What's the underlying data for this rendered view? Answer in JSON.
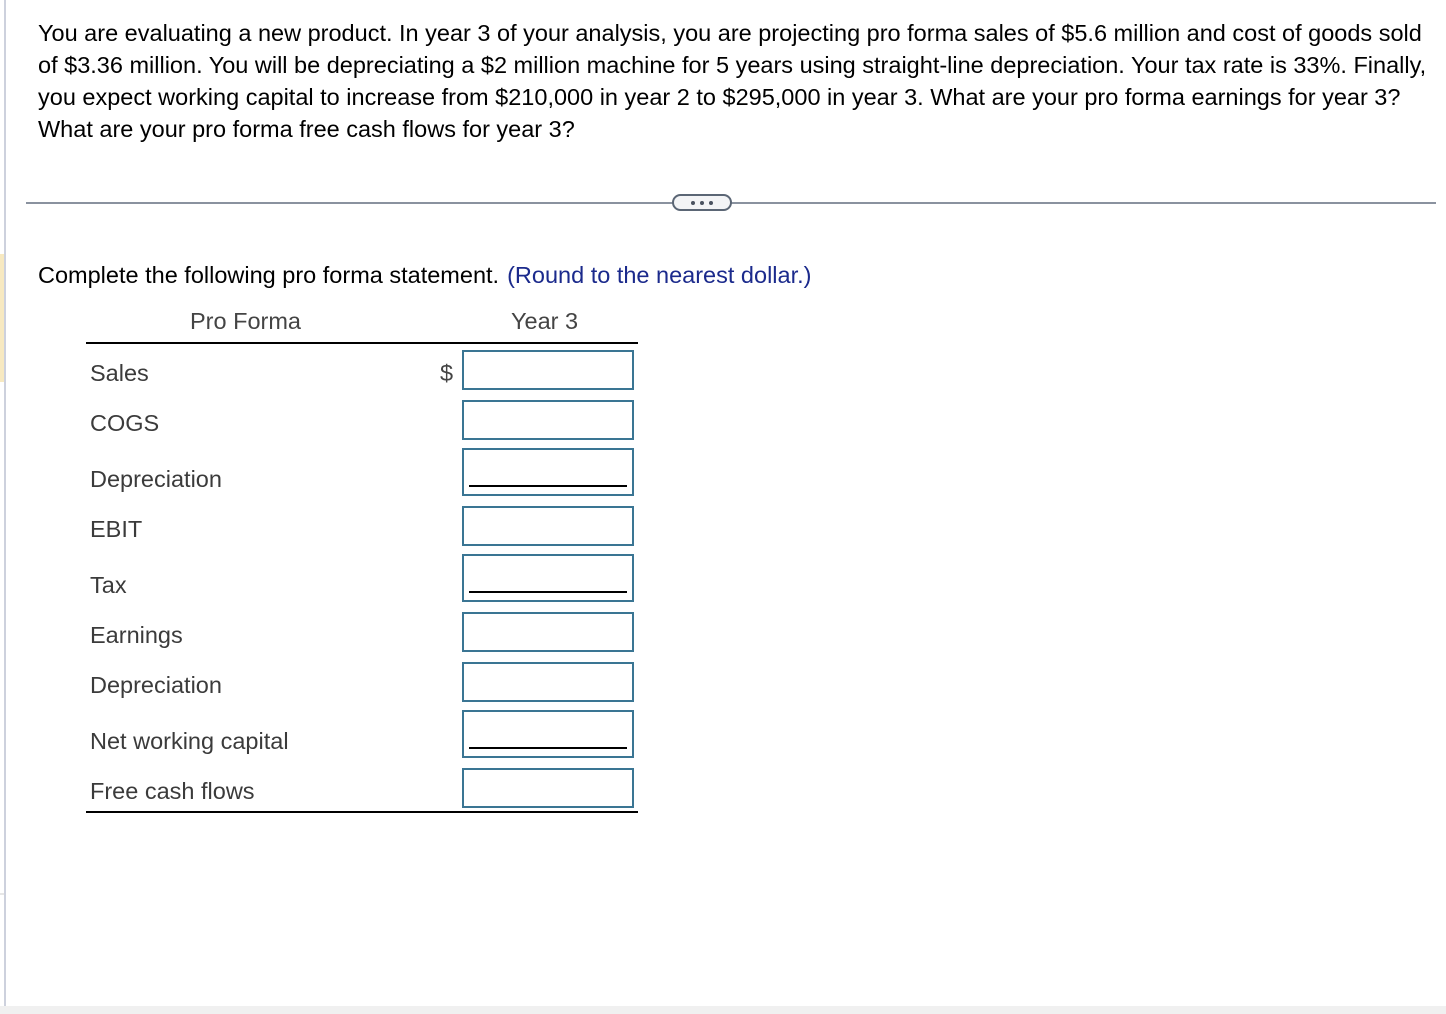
{
  "question": {
    "text": "You are evaluating a new product. In year 3 of your analysis, you are projecting pro forma sales of $5.6 million and cost of goods sold of $3.36 million. You will be depreciating a $2 million machine for 5 years using straight-line depreciation. Your tax rate is 33%. Finally, you expect working capital to increase from $210,000 in year 2 to $295,000 in year 3. What are your pro forma earnings for year 3? What are your pro forma free cash flows for year 3?"
  },
  "more_button": {
    "icon": "ellipsis-icon"
  },
  "instruction": {
    "text": "Complete the following pro forma statement.",
    "hint": "(Round to the nearest dollar.)"
  },
  "table": {
    "headers": {
      "label": "Pro Forma",
      "year": "Year 3"
    },
    "currency_symbol": "$",
    "rows": [
      {
        "label": "Sales",
        "value": "",
        "underlined": false
      },
      {
        "label": "COGS",
        "value": "",
        "underlined": false
      },
      {
        "label": "Depreciation",
        "value": "",
        "underlined": true
      },
      {
        "label": "EBIT",
        "value": "",
        "underlined": false
      },
      {
        "label": "Tax",
        "value": "",
        "underlined": true
      },
      {
        "label": "Earnings",
        "value": "",
        "underlined": false
      },
      {
        "label": "Depreciation",
        "value": "",
        "underlined": false
      },
      {
        "label": "Net working capital",
        "value": "",
        "underlined": true
      },
      {
        "label": "Free cash flows",
        "value": "",
        "underlined": false
      }
    ]
  },
  "colors": {
    "hint": "#1b2a8c",
    "input_border": "#3a7593",
    "separator": "#8a929f"
  }
}
